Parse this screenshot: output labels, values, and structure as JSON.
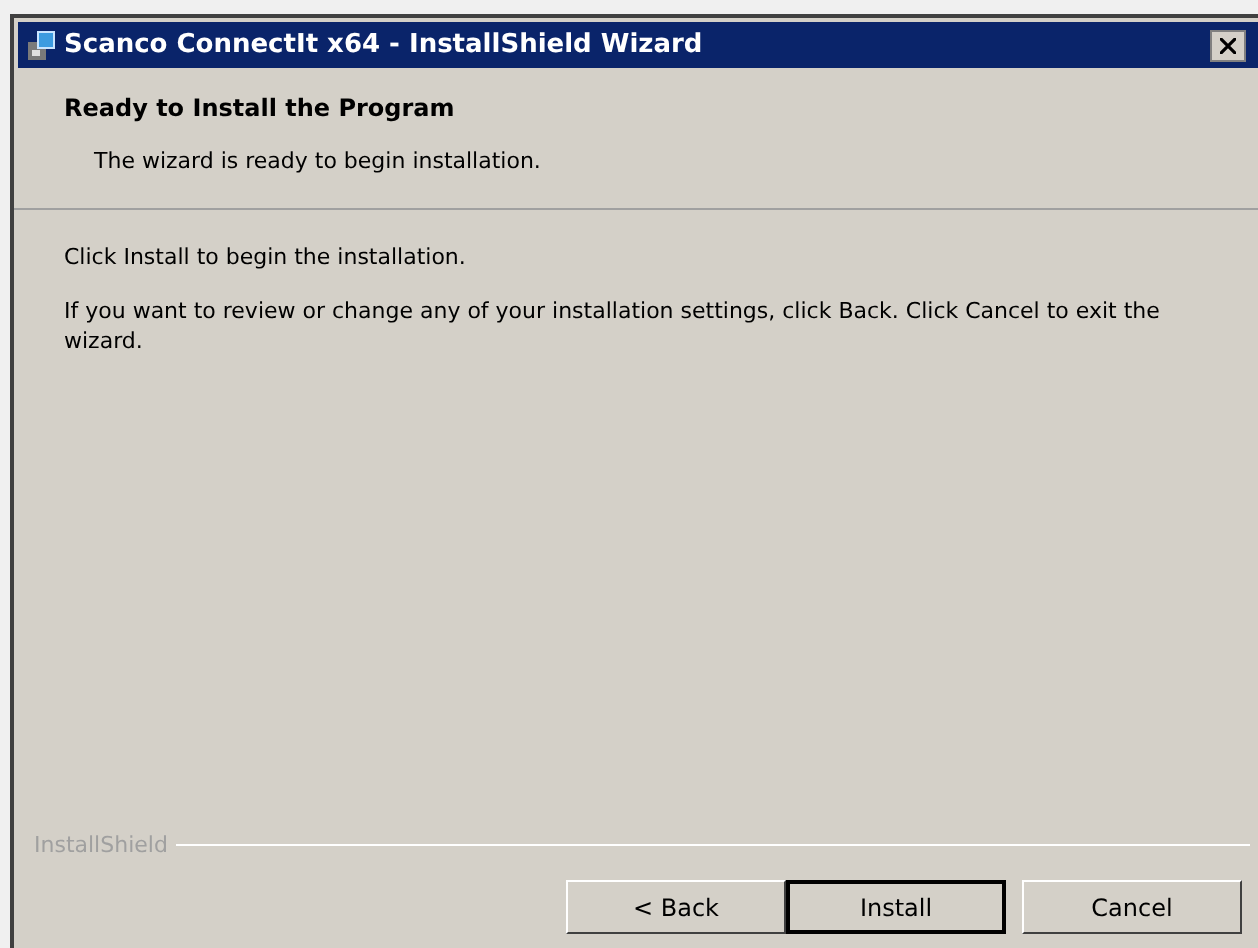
{
  "window": {
    "title": "Scanco ConnectIt x64 - InstallShield Wizard"
  },
  "header": {
    "title": "Ready to Install the Program",
    "subtitle": "The wizard is ready to begin installation."
  },
  "body": [
    "Click Install to begin the installation.",
    "If you want to review or change any of your installation settings, click Back. Click Cancel to exit the wizard."
  ],
  "footer": {
    "brand": "InstallShield"
  },
  "buttons": [
    {
      "label": "< Back",
      "default": false
    },
    {
      "label": "Install",
      "default": true
    },
    {
      "label": "Cancel",
      "default": false
    }
  ]
}
